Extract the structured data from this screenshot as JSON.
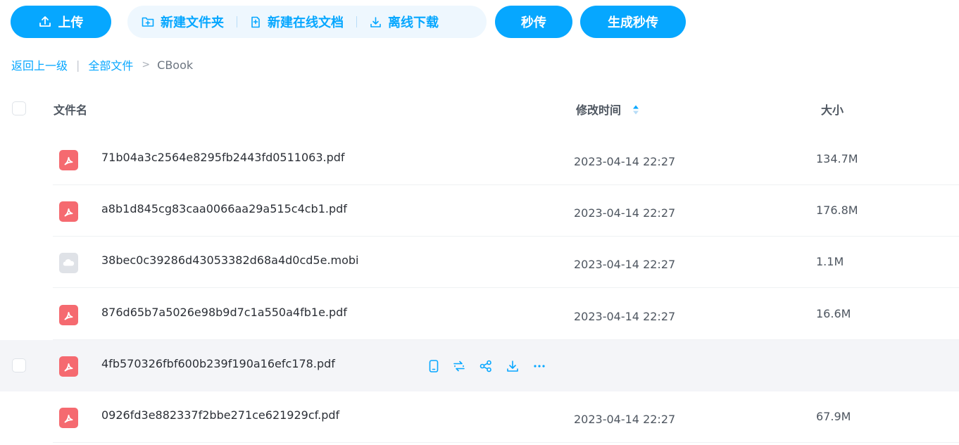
{
  "toolbar": {
    "upload_label": "上传",
    "new_folder_label": "新建文件夹",
    "new_online_doc_label": "新建在线文档",
    "offline_download_label": "离线下载",
    "miaochuan_label": "秒传",
    "generate_miaochuan_label": "生成秒传"
  },
  "breadcrumb": {
    "back_label": "返回上一级",
    "all_files_label": "全部文件",
    "current": "CBook"
  },
  "table": {
    "columns": {
      "name": "文件名",
      "modified": "修改时间",
      "size": "大小"
    },
    "rows": [
      {
        "name": "71b04a3c2564e8295fb2443fd0511063.pdf",
        "modified": "2023-04-14 22:27",
        "size": "134.7M",
        "icon": "pdf-icon"
      },
      {
        "name": "a8b1d845cg83caa0066aa29a515c4cb1.pdf",
        "modified": "2023-04-14 22:27",
        "size": "176.8M",
        "icon": "pdf-icon"
      },
      {
        "name": "38bec0c39286d43053382d68a4d0cd5e.mobi",
        "modified": "2023-04-14 22:27",
        "size": "1.1M",
        "icon": "unknown-file-icon"
      },
      {
        "name": "876d65b7a5026e98b9d7c1a550a4fb1e.pdf",
        "modified": "2023-04-14 22:27",
        "size": "16.6M",
        "icon": "pdf-icon"
      },
      {
        "name": "4fb570326fbf600b239f190a16efc178.pdf",
        "modified": "",
        "size": "",
        "icon": "pdf-icon"
      },
      {
        "name": "0926fd3e882337f2bbe271ce621929cf.pdf",
        "modified": "2023-04-14 22:27",
        "size": "67.9M",
        "icon": "pdf-icon"
      }
    ]
  },
  "row_actions": [
    "phone-icon",
    "convert-icon",
    "share-icon",
    "download-icon",
    "more-icon"
  ],
  "colors": {
    "accent": "#06a7ff",
    "pdf_red": "#f56a70",
    "hover_bg": "#f4f5f8"
  }
}
